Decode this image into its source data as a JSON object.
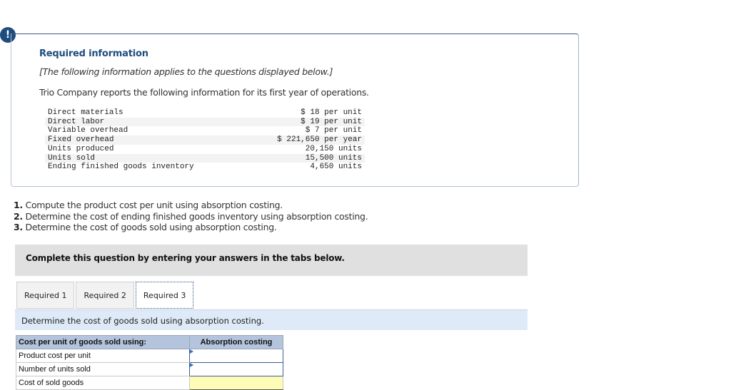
{
  "alert": {
    "icon": "!",
    "icon_name": "exclamation-icon"
  },
  "required_info": {
    "title": "Required information",
    "note": "[The following information applies to the questions displayed below.]",
    "intro": "Trio Company reports the following information for its first year of operations.",
    "rows": [
      {
        "label": "Direct materials",
        "value": "$ 18 per unit"
      },
      {
        "label": "Direct labor",
        "value": "$ 19 per unit"
      },
      {
        "label": "Variable overhead",
        "value": "$ 7 per unit"
      },
      {
        "label": "Fixed overhead",
        "value": "$ 221,650 per year"
      },
      {
        "label": "Units produced",
        "value": "20,150 units"
      },
      {
        "label": "Units sold",
        "value": "15,500 units"
      },
      {
        "label": "Ending finished goods inventory",
        "value": "4,650 units"
      }
    ]
  },
  "questions": [
    {
      "num": "1.",
      "text": " Compute the product cost per unit using absorption costing."
    },
    {
      "num": "2.",
      "text": " Determine the cost of ending finished goods inventory using absorption costing."
    },
    {
      "num": "3.",
      "text": " Determine the cost of goods sold using absorption costing."
    }
  ],
  "complete_bar": "Complete this question by entering your answers in the tabs below.",
  "tabs": [
    {
      "label": "Required 1",
      "active": false
    },
    {
      "label": "Required 2",
      "active": false
    },
    {
      "label": "Required 3",
      "active": true
    }
  ],
  "instruction": "Determine the cost of goods sold using absorption costing.",
  "answer_table": {
    "header_label": "Cost per unit of goods sold using:",
    "header_value": "Absorption costing",
    "rows": [
      {
        "label": "Product cost per unit",
        "value": ""
      },
      {
        "label": "Number of units sold",
        "value": ""
      },
      {
        "label": "Cost of sold goods",
        "value": ""
      }
    ]
  }
}
